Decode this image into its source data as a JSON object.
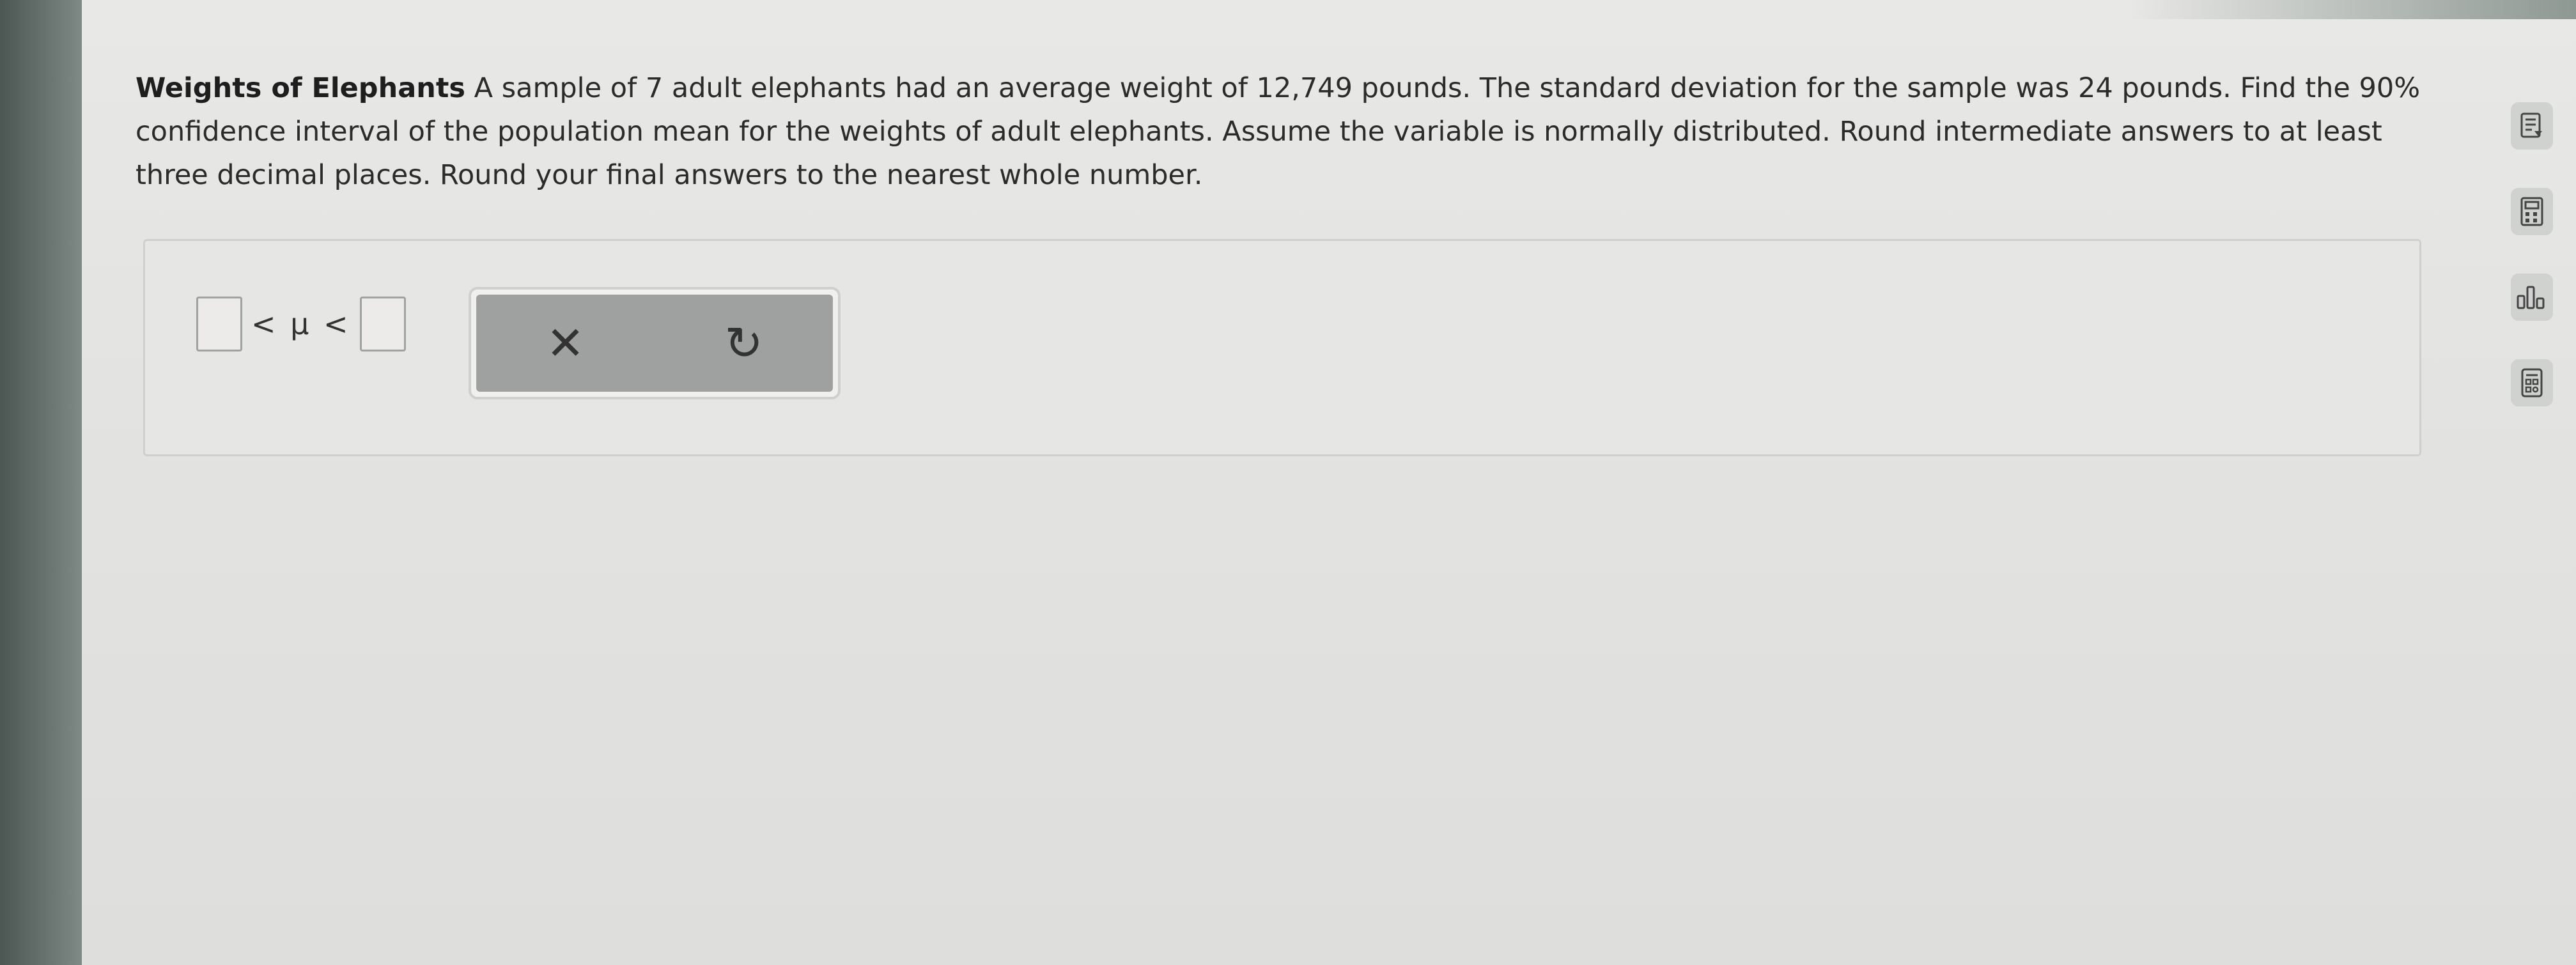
{
  "problem": {
    "title": "Weights of Elephants",
    "text": "A sample of 7 adult elephants had an average weight of 12,749 pounds. The standard deviation for the sample was 24 pounds. Find the 90% confidence interval of the population mean for the weights of adult elephants. Assume the variable is normally distributed. Round intermediate answers to at least three decimal places. Round your final answers to the nearest whole number."
  },
  "answer": {
    "lower_value": "",
    "upper_value": "",
    "inequality_text": "< μ <"
  },
  "actions": {
    "clear_symbol": "✕",
    "reset_symbol": "↻"
  },
  "side_tools": [
    {
      "icon": "notes-icon"
    },
    {
      "icon": "calculator-icon"
    },
    {
      "icon": "bar-chart-icon"
    },
    {
      "icon": "table-icon"
    }
  ]
}
